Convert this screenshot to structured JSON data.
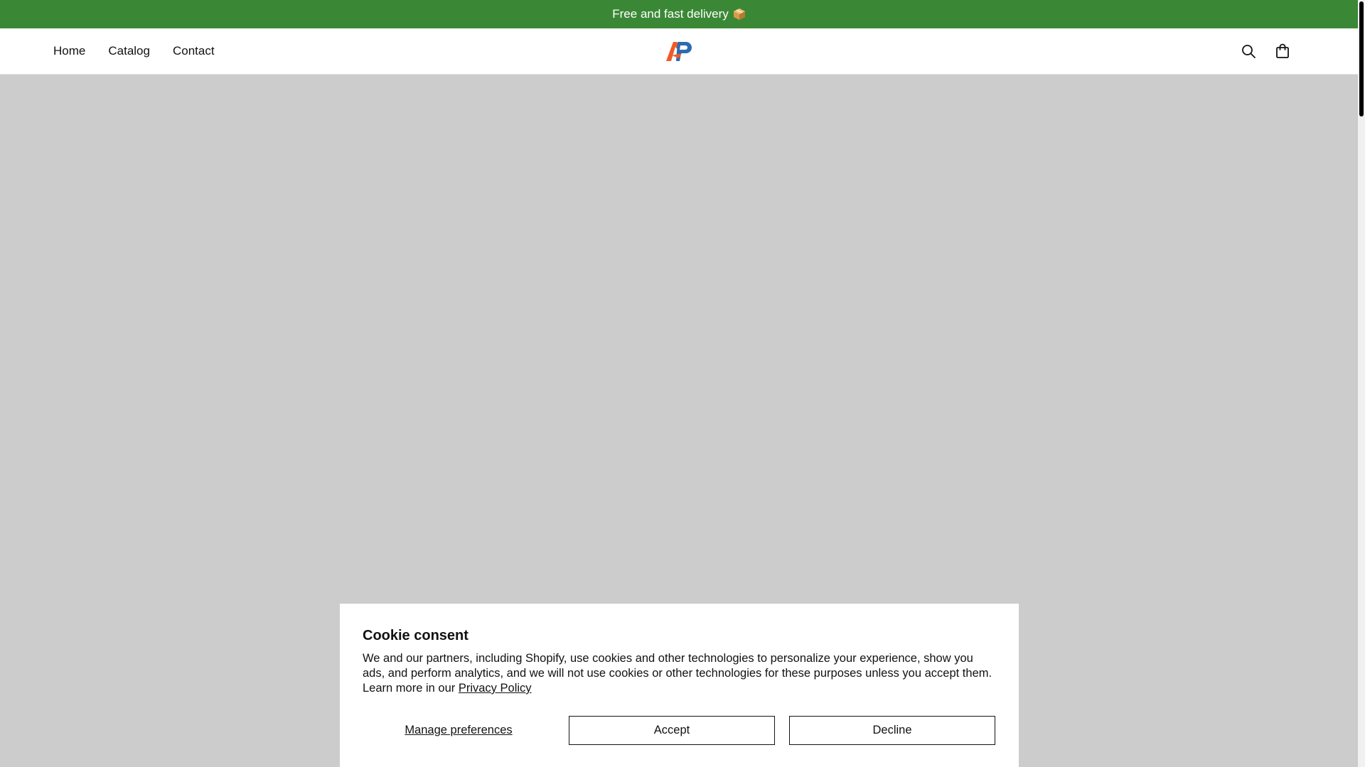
{
  "announcement": {
    "text": "Free and fast delivery",
    "emoji_icon": "package-icon"
  },
  "header": {
    "nav": [
      {
        "label": "Home"
      },
      {
        "label": "Catalog"
      },
      {
        "label": "Contact"
      }
    ],
    "logo": "AP logo",
    "icons": [
      "search-icon",
      "cart-icon"
    ]
  },
  "cookie": {
    "title": "Cookie consent",
    "body": "We and our partners, including Shopify, use cookies and other technologies to personalize your experience, show you ads, and perform analytics, and we will not use cookies or other technologies for these purposes unless you accept them. Learn more in our",
    "privacy_link": "Privacy Policy",
    "manage_label": "Manage preferences",
    "accept_label": "Accept",
    "decline_label": "Decline"
  },
  "colors": {
    "announcement_bg": "#3a8836",
    "hero_placeholder": "#cccccc",
    "logo_orange": "#f05a28",
    "logo_blue": "#2b6cb0"
  }
}
